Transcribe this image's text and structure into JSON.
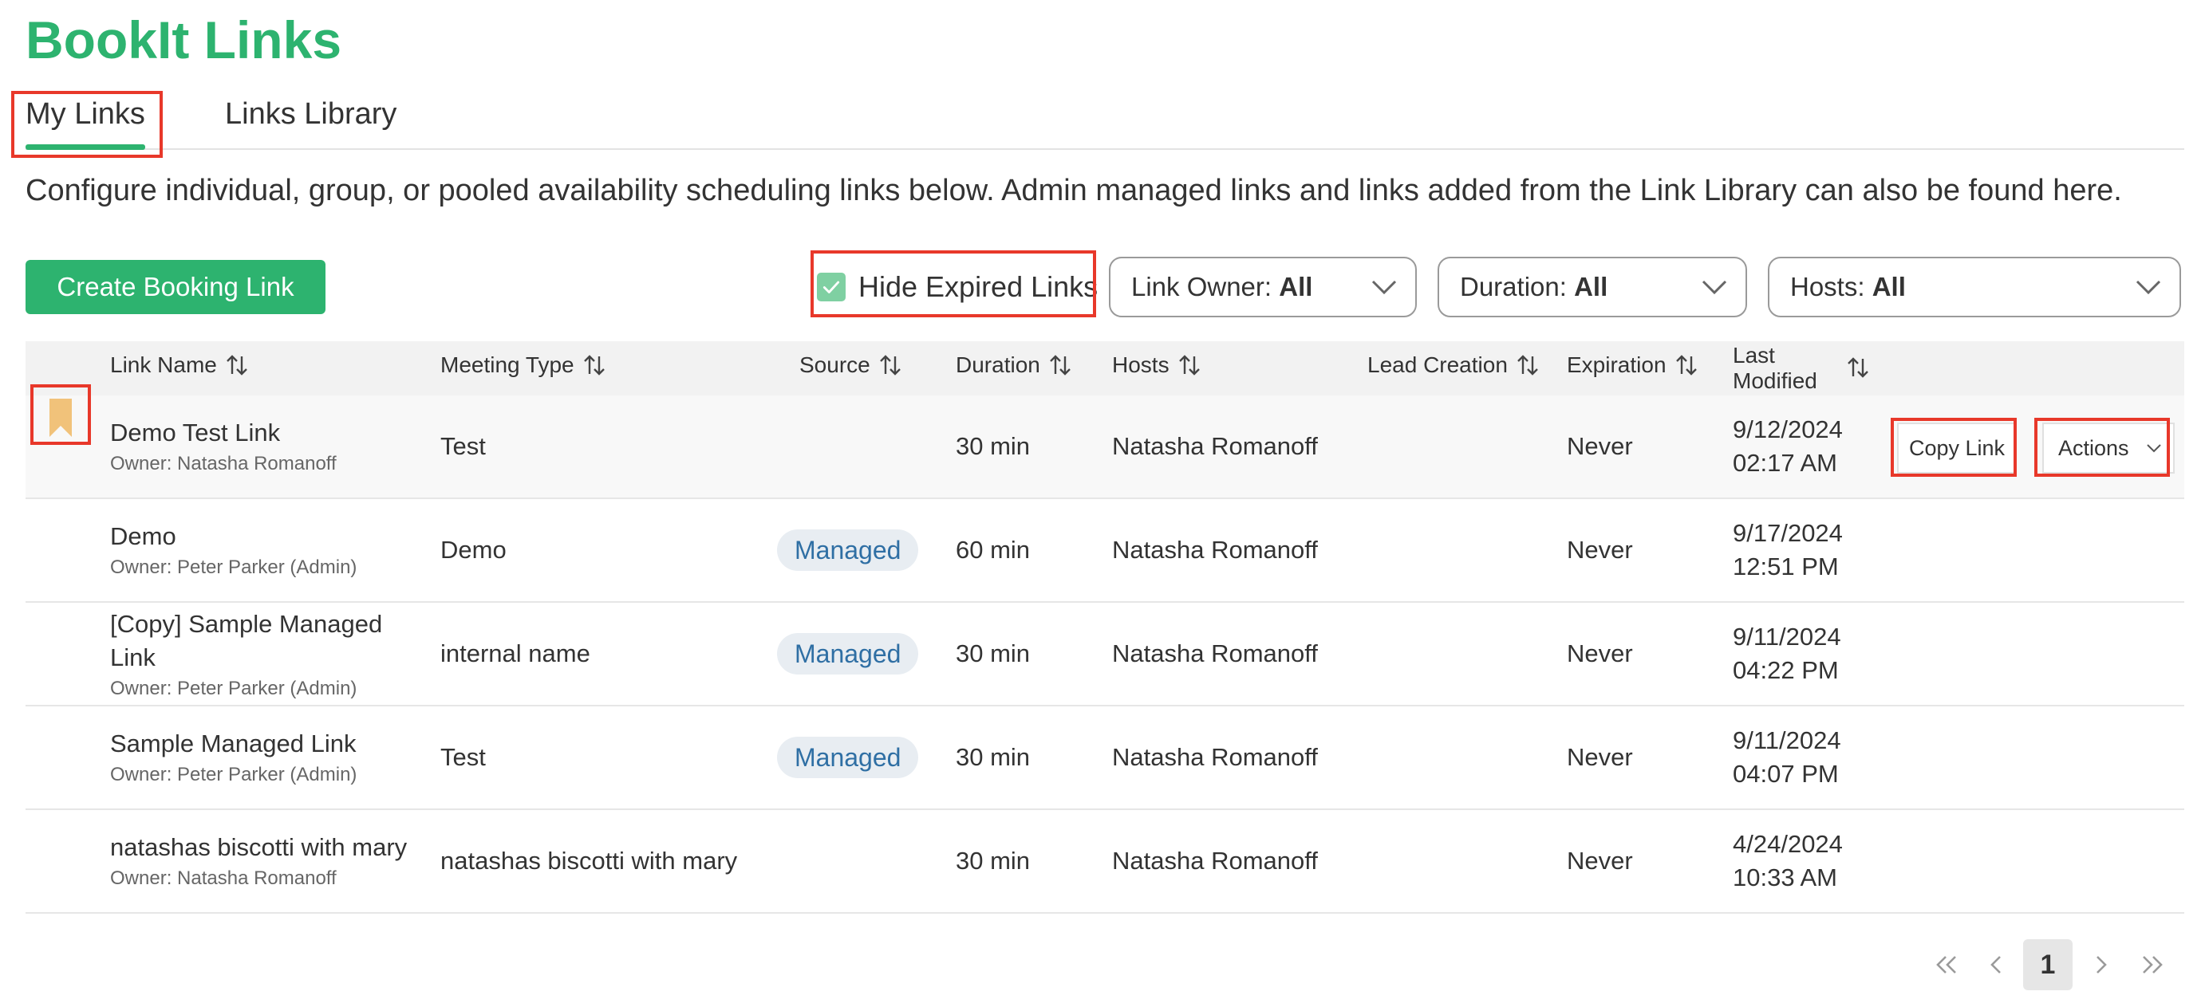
{
  "app": {
    "title": "BookIt Links"
  },
  "tabs": [
    {
      "label": "My Links",
      "active": true
    },
    {
      "label": "Links Library",
      "active": false
    }
  ],
  "description": "Configure individual, group, or pooled availability scheduling links below. Admin managed links and links added from the Link Library can also be found here.",
  "toolbar": {
    "create_label": "Create Booking Link",
    "hide_expired_label": "Hide Expired Links",
    "hide_expired_checked": true,
    "filters": [
      {
        "label": "Link Owner:",
        "value": "All"
      },
      {
        "label": "Duration:",
        "value": "All"
      },
      {
        "label": "Hosts:",
        "value": "All"
      }
    ]
  },
  "table": {
    "columns": {
      "name": "Link Name",
      "meeting_type": "Meeting Type",
      "source": "Source",
      "duration": "Duration",
      "hosts": "Hosts",
      "lead_creation": "Lead Creation",
      "expiration": "Expiration",
      "last_modified_1": "Last",
      "last_modified_2": "Modified"
    },
    "rows": [
      {
        "name": "Demo Test Link",
        "name_2": "",
        "owner": "Owner: Natasha Romanoff",
        "meeting_type": "Test",
        "source": "",
        "duration": "30 min",
        "hosts": "Natasha Romanoff",
        "lead_creation": "",
        "expiration": "Never",
        "modified_date": "9/12/2024",
        "modified_time": "02:17 AM"
      },
      {
        "name": "Demo",
        "name_2": "",
        "owner": "Owner: Peter Parker (Admin)",
        "meeting_type": "Demo",
        "source": "Managed",
        "duration": "60 min",
        "hosts": "Natasha Romanoff",
        "lead_creation": "",
        "expiration": "Never",
        "modified_date": "9/17/2024",
        "modified_time": "12:51 PM"
      },
      {
        "name": "[Copy] Sample Managed",
        "name_2": "Link",
        "owner": "Owner: Peter Parker (Admin)",
        "meeting_type": "internal name",
        "source": "Managed",
        "duration": "30 min",
        "hosts": "Natasha Romanoff",
        "lead_creation": "",
        "expiration": "Never",
        "modified_date": "9/11/2024",
        "modified_time": "04:22 PM"
      },
      {
        "name": "Sample Managed Link",
        "name_2": "",
        "owner": "Owner: Peter Parker (Admin)",
        "meeting_type": "Test",
        "source": "Managed",
        "duration": "30 min",
        "hosts": "Natasha Romanoff",
        "lead_creation": "",
        "expiration": "Never",
        "modified_date": "9/11/2024",
        "modified_time": "04:07 PM"
      },
      {
        "name": "natashas biscotti with mary",
        "name_2": "",
        "owner": "Owner: Natasha Romanoff",
        "meeting_type": "natashas biscotti with mary",
        "source": "",
        "duration": "30 min",
        "hosts": "Natasha Romanoff",
        "lead_creation": "",
        "expiration": "Never",
        "modified_date": "4/24/2024",
        "modified_time": "10:33 AM"
      }
    ],
    "row_actions": {
      "copy_label": "Copy Link",
      "actions_label": "Actions"
    }
  },
  "pagination": {
    "current_page": "1"
  },
  "colors": {
    "brand_green": "#2db36f",
    "bookmark": "#f1c27a",
    "managed_text": "#2f6fa4",
    "highlight_red": "#e8382a"
  }
}
